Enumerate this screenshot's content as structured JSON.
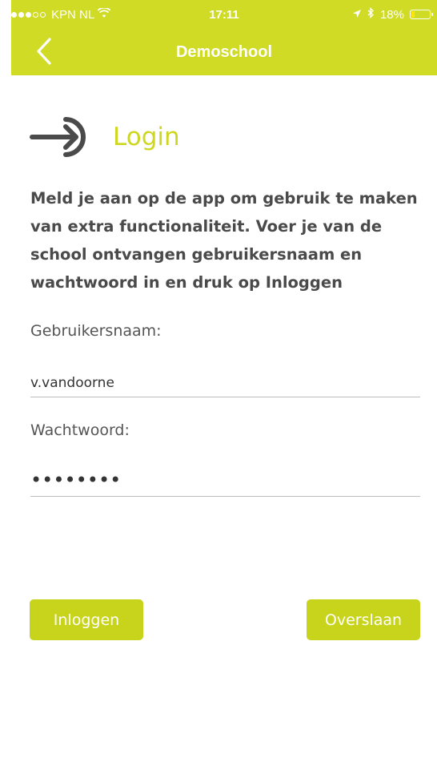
{
  "status_bar": {
    "carrier": "KPN NL",
    "time": "17:11",
    "battery_percent": "18%",
    "battery_level": 0.18,
    "signal_bars_filled": 3,
    "signal_bars_total": 5
  },
  "nav": {
    "title": "Demoschool",
    "back_icon": "chevron-left-icon"
  },
  "login": {
    "title": "Login",
    "icon": "sign-in-icon",
    "intro": "Meld je aan op de app om gebruik te maken van extra functionaliteit. Voer je van de school ontvangen gebruikersnaam en wachtwoord in en druk op Inloggen",
    "username_label": "Gebruikersnaam:",
    "username_value": "v.vandoorne",
    "password_label": "Wachtwoord:",
    "password_value": "••••••••",
    "login_button": "Inloggen",
    "skip_button": "Overslaan"
  },
  "colors": {
    "accent": "#cfdb24",
    "button": "#c8d41c",
    "text": "#4a4a4a"
  }
}
